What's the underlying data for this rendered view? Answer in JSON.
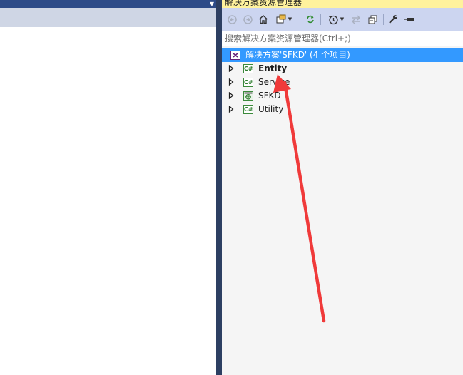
{
  "colors": {
    "left_topbar": "#2d4b88",
    "tabstrip": "#cfd6e5",
    "splitter": "#2d3f62",
    "se_title_bg": "#fff29d",
    "se_toolbar_bg": "#ccd5f0",
    "selection": "#3399ff",
    "tree_bg": "#f5f5f5",
    "annotation_arrow": "#f03a3a"
  },
  "left_panel": {
    "dropdown_icon": "chevron-down-icon"
  },
  "solution_explorer": {
    "title": "解决方案资源管理器",
    "toolbar": {
      "icons": [
        "back-icon",
        "forward-icon",
        "home-icon",
        "switch-views-icon",
        "sync-icon",
        "pending-changes-icon",
        "show-all-files-icon",
        "collapse-all-icon",
        "properties-icon",
        "pin-icon"
      ]
    },
    "search": {
      "placeholder": "搜索解决方案资源管理器(Ctrl+;)"
    },
    "tree": {
      "solution": {
        "label": "解决方案'SFKD' (4 个项目)",
        "icon": "solution-icon",
        "selected": true
      },
      "projects": [
        {
          "label": "Entity",
          "icon": "csharp-project-icon",
          "bold": true
        },
        {
          "label": "Service",
          "icon": "csharp-project-icon",
          "bold": false
        },
        {
          "label": "SFKD",
          "icon": "web-project-icon",
          "bold": false
        },
        {
          "label": "Utility",
          "icon": "csharp-project-icon",
          "bold": false
        }
      ]
    }
  }
}
